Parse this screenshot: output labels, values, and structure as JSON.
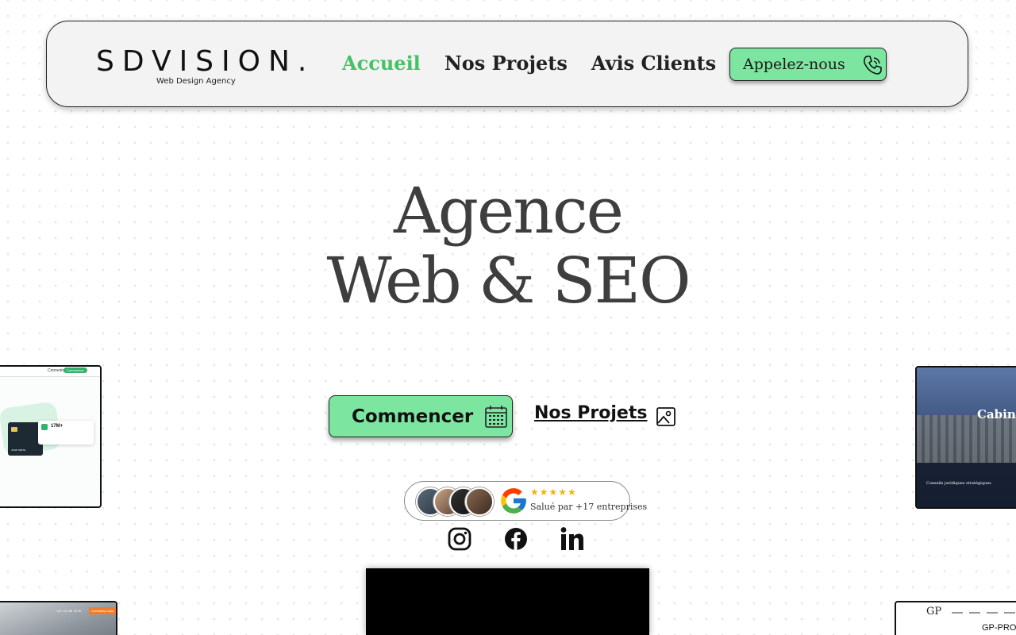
{
  "header": {
    "logo_main": "SDVISION.",
    "logo_sub": "Web Design Agency",
    "nav": [
      {
        "label": "Accueil",
        "active": true
      },
      {
        "label": "Nos Projets",
        "active": false
      },
      {
        "label": "Avis Clients",
        "active": false
      }
    ],
    "call_button": "Appelez-nous"
  },
  "hero": {
    "title_line1": "Agence",
    "title_line2": "Web & SEO",
    "cta_button": "Commencer",
    "projects_link": "Nos Projets"
  },
  "reviews": {
    "stars": "★★★★★",
    "text": "Salué par +17 entreprises"
  },
  "social": {
    "icons": [
      "instagram-icon",
      "facebook-icon",
      "linkedin-icon"
    ]
  },
  "previews": {
    "left1": {
      "nav_link": "Connexion",
      "nav_button": "Commencer",
      "stat": "17M+",
      "card_name": "JOHN SMITH"
    },
    "right1": {
      "title": "Cabine",
      "subtitle": "Conseils juridiques stratégiques"
    },
    "left2": {
      "phone": "+33 1 42 56 78 90",
      "button": "Contactez-nous"
    },
    "right2": {
      "logo": "GP",
      "title": "GP-PRO"
    }
  },
  "colors": {
    "accent_green": "#7ce6a0",
    "active_nav": "#45c266",
    "title_gray": "#3e3e3e"
  }
}
